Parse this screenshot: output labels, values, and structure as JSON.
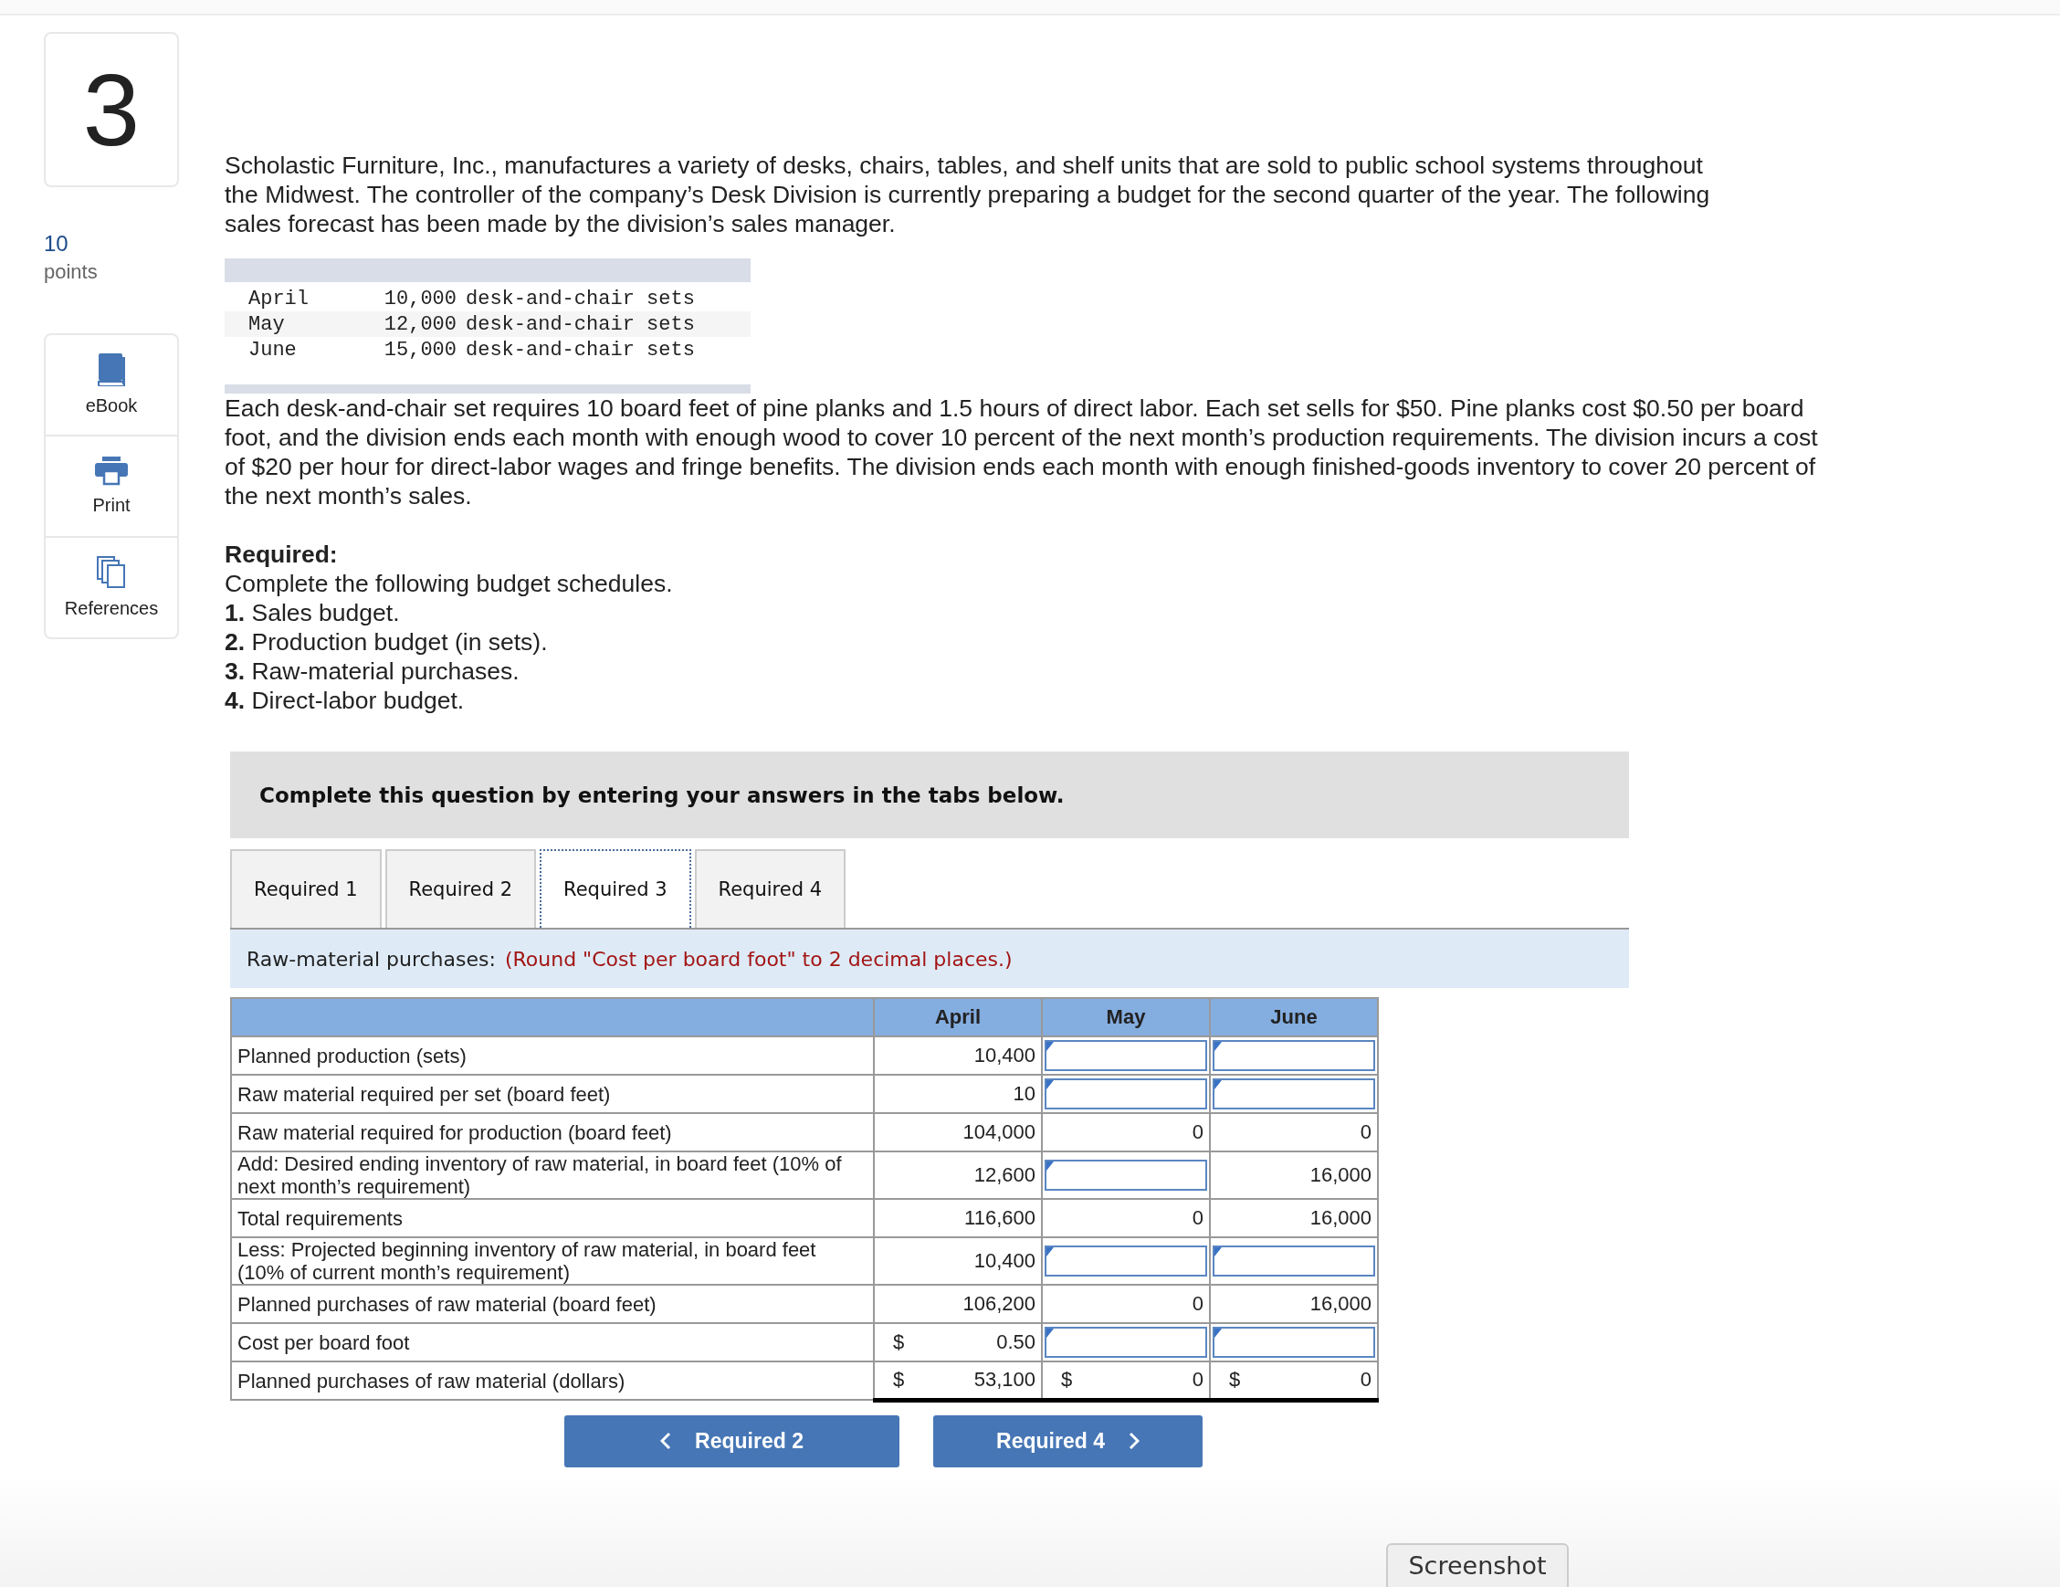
{
  "question": {
    "number": "3",
    "points_value": "10",
    "points_label": "points"
  },
  "tools": [
    {
      "kind": "book",
      "label": "eBook"
    },
    {
      "kind": "printer",
      "label": "Print"
    },
    {
      "kind": "pages",
      "label": "References"
    }
  ],
  "intro": "Scholastic Furniture, Inc., manufactures a variety of desks, chairs, tables, and shelf units that are sold to public school systems throughout the Midwest. The controller of the company’s Desk Division is currently preparing a budget for the second quarter of the year. The following sales forecast has been made by the division’s sales manager.",
  "forecast": [
    {
      "month": "April",
      "amount": "10,000",
      "unit": "desk-and-chair sets"
    },
    {
      "month": "May",
      "amount": "12,000",
      "unit": "desk-and-chair sets"
    },
    {
      "month": "June",
      "amount": "15,000",
      "unit": "desk-and-chair sets"
    }
  ],
  "details": "Each desk-and-chair set requires 10 board feet of pine planks and 1.5 hours of direct labor. Each set sells for $50. Pine planks cost $0.50 per board foot, and the division ends each month with enough wood to cover 10 percent of the next month’s production requirements. The division incurs a cost of $20 per hour for direct-labor wages and fringe benefits. The division ends each month with enough finished-goods inventory to cover 20 percent of the next month’s sales.",
  "required": {
    "heading": "Required:",
    "lines": [
      "Complete the following budget schedules.",
      "**1.** Sales budget.",
      "**2.** Production budget (in sets).",
      "**3.** Raw-material purchases.",
      "**4.** Direct-labor budget."
    ]
  },
  "instruction_banner": "Complete this question by entering your answers in the tabs below.",
  "tabs": [
    {
      "label": "Required 1",
      "selected": false
    },
    {
      "label": "Required 2",
      "selected": false
    },
    {
      "label": "Required 3",
      "selected": true
    },
    {
      "label": "Required 4",
      "selected": false
    }
  ],
  "section": {
    "title": "Raw-material purchases:",
    "note": "(Round \"Cost per board foot\" to 2 decimal places.)"
  },
  "table": {
    "columns": [
      "April",
      "May",
      "June"
    ],
    "rows": [
      {
        "label": "Planned production (sets)",
        "cells": [
          {
            "kind": "text",
            "value": "10,400"
          },
          {
            "kind": "input"
          },
          {
            "kind": "input"
          }
        ]
      },
      {
        "label": "Raw material required per set (board feet)",
        "cells": [
          {
            "kind": "text",
            "value": "10"
          },
          {
            "kind": "input"
          },
          {
            "kind": "input"
          }
        ]
      },
      {
        "label": "Raw material required for production (board feet)",
        "cells": [
          {
            "kind": "text",
            "value": "104,000"
          },
          {
            "kind": "text",
            "value": "0"
          },
          {
            "kind": "text",
            "value": "0"
          }
        ]
      },
      {
        "label": "Add: Desired ending inventory of raw material, in board feet (10% of next month’s requirement)",
        "cells": [
          {
            "kind": "text",
            "value": "12,600"
          },
          {
            "kind": "input"
          },
          {
            "kind": "text",
            "value": "16,000"
          }
        ]
      },
      {
        "label": "Total requirements",
        "cells": [
          {
            "kind": "text",
            "value": "116,600"
          },
          {
            "kind": "text",
            "value": "0"
          },
          {
            "kind": "text",
            "value": "16,000"
          }
        ]
      },
      {
        "label": "Less: Projected beginning inventory of raw material, in board feet (10% of current month’s requirement)",
        "cells": [
          {
            "kind": "text",
            "value": "10,400"
          },
          {
            "kind": "input"
          },
          {
            "kind": "input"
          }
        ]
      },
      {
        "label": "Planned purchases of raw material (board feet)",
        "cells": [
          {
            "kind": "text",
            "value": "106,200"
          },
          {
            "kind": "text",
            "value": "0"
          },
          {
            "kind": "text",
            "value": "16,000"
          }
        ]
      },
      {
        "label": "Cost per board foot",
        "cells": [
          {
            "kind": "text",
            "currency": "$",
            "value": "0.50"
          },
          {
            "kind": "input"
          },
          {
            "kind": "input"
          }
        ]
      },
      {
        "label": "Planned purchases of raw material (dollars)",
        "total": true,
        "cells": [
          {
            "kind": "text",
            "currency": "$",
            "value": "53,100"
          },
          {
            "kind": "text",
            "currency": "$",
            "value": "0"
          },
          {
            "kind": "text",
            "currency": "$",
            "value": "0"
          }
        ]
      }
    ]
  },
  "nav": {
    "previous": "Required 2",
    "next": "Required 4"
  },
  "screenshot_button": "Screenshot"
}
